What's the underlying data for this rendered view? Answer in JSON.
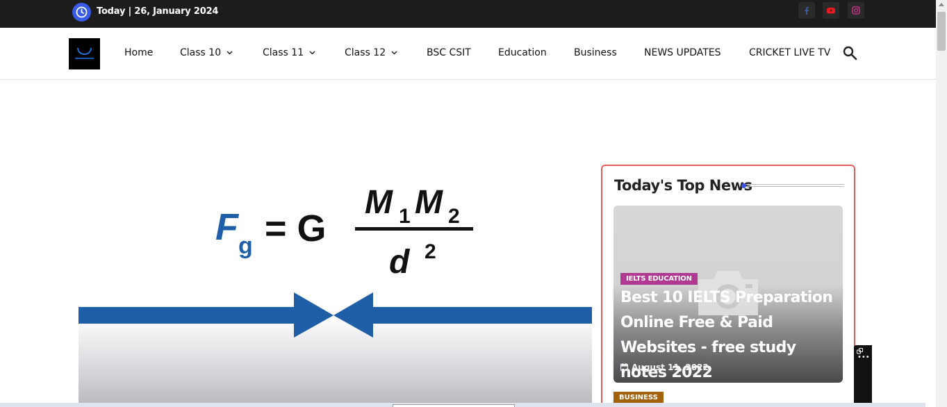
{
  "topbar": {
    "date_text": "Today | 26, January 2024",
    "social": [
      {
        "name": "facebook-icon",
        "color": "#3b5998"
      },
      {
        "name": "youtube-icon",
        "color": "#e51b23"
      },
      {
        "name": "instagram-icon",
        "color": "#c13584"
      }
    ]
  },
  "nav": {
    "items": [
      {
        "label": "Home",
        "dropdown": false
      },
      {
        "label": "Class 10",
        "dropdown": true
      },
      {
        "label": "Class 11",
        "dropdown": true
      },
      {
        "label": "Class 12",
        "dropdown": true
      },
      {
        "label": "BSC CSIT",
        "dropdown": false
      },
      {
        "label": "Education",
        "dropdown": false
      },
      {
        "label": "Business",
        "dropdown": false
      },
      {
        "label": "NEWS UPDATES",
        "dropdown": false
      },
      {
        "label": "CRICKET LIVE TV",
        "dropdown": false
      }
    ]
  },
  "feature": {
    "formula_lhs": "F",
    "formula_lhs_sub": "g",
    "formula_eq": "= G",
    "numerator_a": "M",
    "numerator_a_sub": "1",
    "numerator_b": "M",
    "numerator_b_sub": "2",
    "denominator": "d",
    "denominator_sup": "2",
    "formula_color": "#1e5fa8"
  },
  "sidebar": {
    "title": "Today's Top News",
    "card": {
      "category": "IELTS EDUCATION",
      "title": "Best 10 IELTS Preparation Online Free & Paid Websites - free study notes 2022",
      "date": "August 11, 2022"
    },
    "next_category": "BUSINESS"
  },
  "colors": {
    "accent": "#3f51e6",
    "sidebar_border": "#e35d5d",
    "category_ielts": "#b03a91",
    "category_business": "#a4630a"
  }
}
